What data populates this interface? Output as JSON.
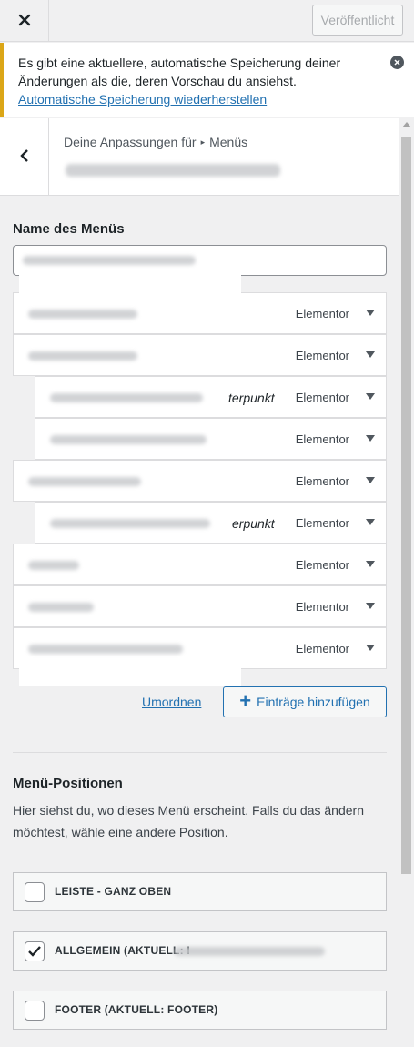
{
  "header": {
    "close_icon": "close-icon",
    "publish_label": "Veröffentlicht"
  },
  "notice": {
    "text": "Es gibt eine aktuellere, automatische Speicherung deiner Änderungen als die, deren Vorschau du ansiehst.",
    "link": "Automatische Speicherung wiederherstellen",
    "accent_color": "#dba617"
  },
  "panel": {
    "breadcrumb_prefix": "Deine Anpassungen für",
    "breadcrumb_section": "Menüs"
  },
  "menu_name": {
    "label": "Name des Menüs"
  },
  "menu_items": [
    {
      "type": "Elementor",
      "subitem": false
    },
    {
      "type": "Elementor",
      "subitem": false
    },
    {
      "type": "Elementor",
      "subitem": true,
      "suffix": "terpunkt"
    },
    {
      "type": "Elementor",
      "subitem": true
    },
    {
      "type": "Elementor",
      "subitem": false
    },
    {
      "type": "Elementor",
      "subitem": true,
      "suffix": "erpunkt"
    },
    {
      "type": "Elementor",
      "subitem": false
    },
    {
      "type": "Elementor",
      "subitem": false
    },
    {
      "type": "Elementor",
      "subitem": false
    }
  ],
  "actions": {
    "reorder": "Umordnen",
    "add_items": "Einträge hinzufügen"
  },
  "locations": {
    "title": "Menü-Positionen",
    "description": "Hier siehst du, wo dieses Menü erscheint. Falls du das ändern möchtest, wähle eine andere Position.",
    "items": [
      {
        "label": "LEISTE - GANZ OBEN",
        "checked": false
      },
      {
        "label": "ALLGEMEIN (AKTUELL: I",
        "checked": true
      },
      {
        "label": "FOOTER (AKTUELL: FOOTER)",
        "checked": false
      }
    ]
  },
  "colors": {
    "link": "#2271b1",
    "background": "#f0f0f1"
  }
}
